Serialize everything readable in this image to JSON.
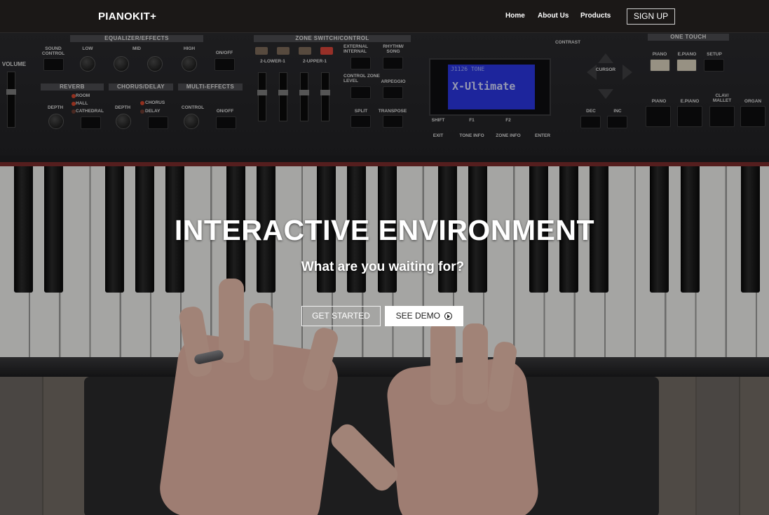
{
  "navbar": {
    "brand": "PIANOKIT+",
    "links": [
      "Home",
      "About Us",
      "Products"
    ],
    "signup_label": "SIGN UP"
  },
  "hero": {
    "title": "INTERACTIVE ENVIRONMENT",
    "subtitle": "What are you waiting for?",
    "primary_button": "GET STARTED",
    "secondary_button": "SEE DEMO",
    "secondary_icon": "play-circle-icon"
  },
  "keyboard_panel": {
    "sections": [
      "EQUALIZER/EFFECTS",
      "ZONE SWITCH/CONTROL",
      "ONE TOUCH",
      "REVERB",
      "CHORUS/DELAY",
      "MULTI-EFFECTS"
    ],
    "labels": {
      "volume": "VOLUME",
      "sound_control": "SOUND CONTROL",
      "low": "LOW",
      "mid": "MID",
      "high": "HIGH",
      "on_off": "ON/OFF",
      "room": "ROOM",
      "hall": "HALL",
      "cathedral": "CATHEDRAL",
      "depth": "DEPTH",
      "chorus": "CHORUS",
      "delay": "DELAY",
      "control": "CONTROL",
      "lower": "2-LOWER-1",
      "upper": "2-UPPER-1",
      "external": "EXTERNAL INTERNAL",
      "rhythm": "RHYTHM/ SONG",
      "zone_level": "CONTROL ZONE LEVEL",
      "arpeggio": "ARPEGGIO",
      "split": "SPLIT",
      "transpose": "TRANSPOSE",
      "shift": "SHIFT",
      "exit": "EXIT",
      "f1": "F1",
      "f2": "F2",
      "tone_info": "TONE INFO",
      "zone_info": "ZONE INFO",
      "enter": "ENTER",
      "contrast": "CONTRAST",
      "cursor": "CURSOR",
      "dec": "DEC",
      "inc": "INC",
      "piano": "PIANO",
      "epiano": "E.PIANO",
      "setup": "SETUP",
      "clav": "CLAV/ MALLET",
      "organ": "ORGAN"
    },
    "lcd": {
      "top_line": "J1126  TONE",
      "main_line": "X-Ultimate"
    }
  }
}
